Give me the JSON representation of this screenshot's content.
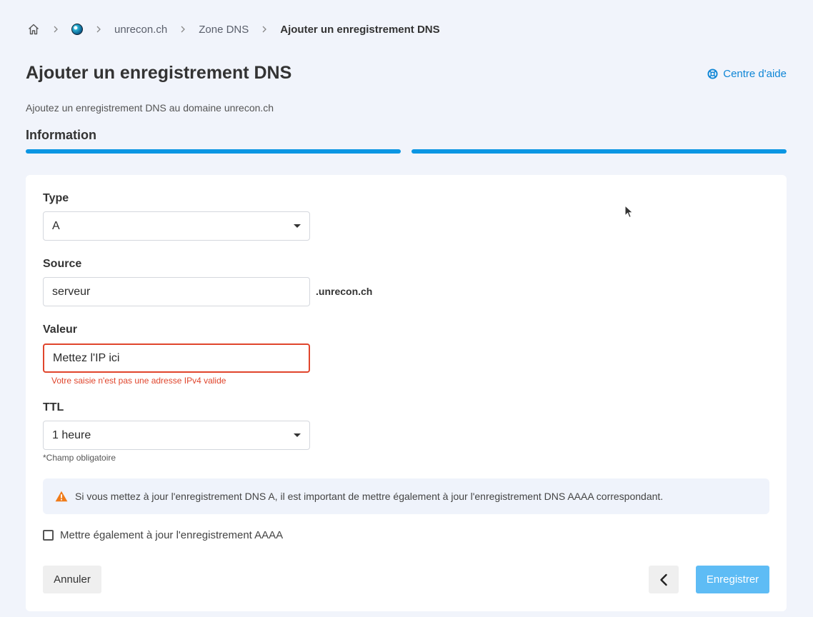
{
  "breadcrumb": {
    "home_icon": "home-icon",
    "globe_icon": "globe-icon",
    "domain": "unrecon.ch",
    "zone": "Zone DNS",
    "current": "Ajouter un enregistrement DNS"
  },
  "header": {
    "title": "Ajouter un enregistrement DNS",
    "help_label": "Centre d'aide",
    "help_icon": "lifebuoy-icon",
    "subtitle": "Ajoutez un enregistrement DNS au domaine unrecon.ch"
  },
  "wizard": {
    "section_title": "Information",
    "steps_total": 2,
    "steps_completed": 2
  },
  "form": {
    "type": {
      "label": "Type",
      "value": "A"
    },
    "source": {
      "label": "Source",
      "value": "serveur",
      "suffix": ".unrecon.ch"
    },
    "valeur": {
      "label": "Valeur",
      "value": "Mettez l'IP ici",
      "error": "Votre saisie n'est pas une adresse IPv4 valide"
    },
    "ttl": {
      "label": "TTL",
      "value": "1 heure"
    },
    "required_note": "*Champ obligatoire"
  },
  "alert": {
    "icon": "warning-icon",
    "text": "Si vous mettez à jour l'enregistrement DNS A, il est important de mettre également à jour l'enregistrement DNS AAAA correspondant."
  },
  "checkbox": {
    "label": "Mettre également à jour l'enregistrement AAAA",
    "checked": false
  },
  "actions": {
    "cancel": "Annuler",
    "back_icon": "chevron-left-icon",
    "save": "Enregistrer"
  },
  "colors": {
    "accent": "#0c96e3",
    "error": "#e0452c",
    "save_button": "#5ebcf5",
    "warning": "#f07c1a"
  }
}
